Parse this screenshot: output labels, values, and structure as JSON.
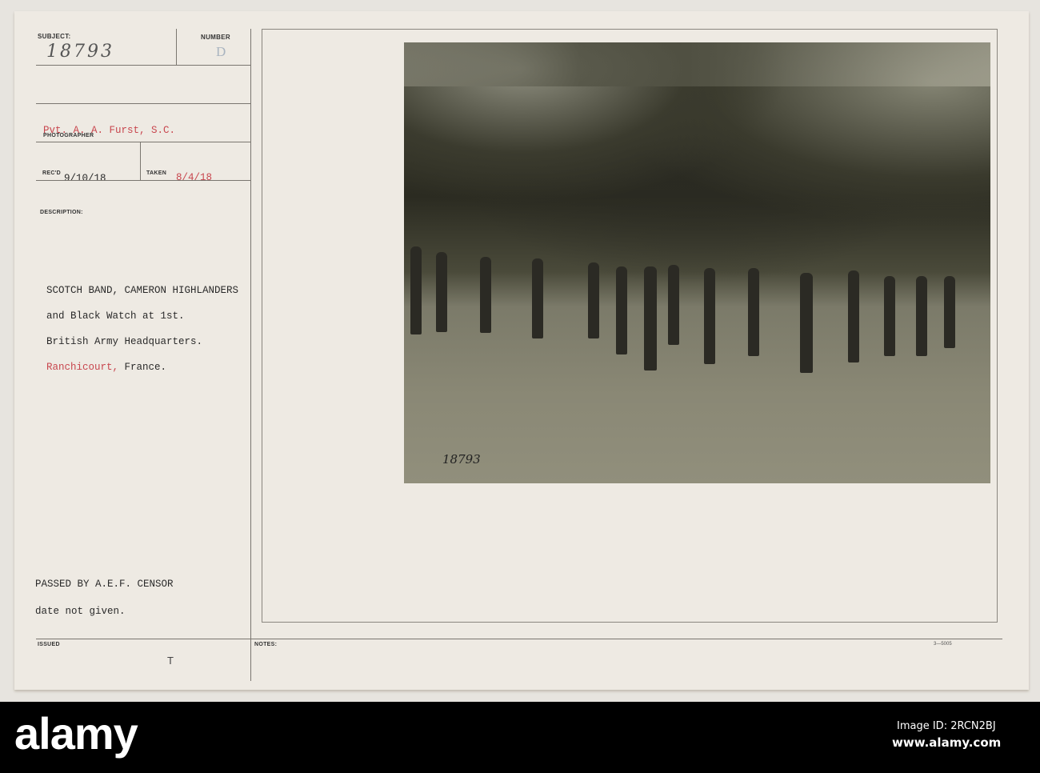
{
  "card": {
    "subject_label": "SUBJECT:",
    "subject_value": "18793",
    "number_label": "NUMBER",
    "number_value": "D",
    "photographer_label": "PHOTOGRAPHER",
    "photographer_value": "Pvt. A. A. Furst, S.C.",
    "recd_label": "REC'D",
    "recd_value": "9/10/18",
    "taken_label": "TAKEN",
    "taken_value": "8/4/18",
    "description_label": "DESCRIPTION:",
    "description_lines": [
      "SCOTCH BAND, CAMERON HIGHLANDERS",
      "and Black Watch at 1st.",
      "British Army Headquarters."
    ],
    "location_red": "Ranchicourt,",
    "location_rest": " France.",
    "censor_lines": [
      "PASSED BY A.E.F. CENSOR",
      "date not given."
    ],
    "issued_label": "ISSUED",
    "issued_value": "T",
    "notes_label": "NOTES:",
    "form_number": "3—5005",
    "photo_number": "18793"
  },
  "footer": {
    "logo": "alamy",
    "image_id": "Image ID: 2RCN2BJ",
    "url": "www.alamy.com"
  }
}
